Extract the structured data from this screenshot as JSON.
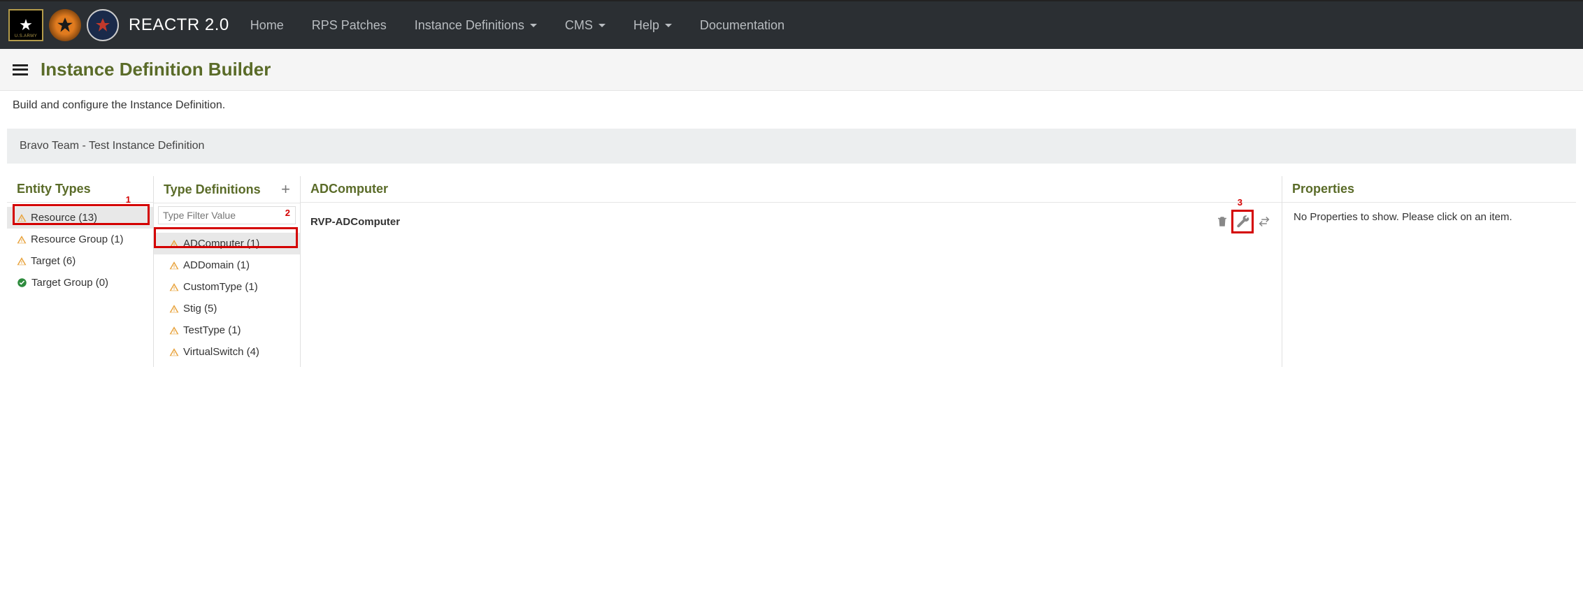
{
  "brand": "REACTR 2.0",
  "nav": {
    "home": "Home",
    "rps": "RPS Patches",
    "instdef": "Instance Definitions",
    "cms": "CMS",
    "help": "Help",
    "docs": "Documentation"
  },
  "page": {
    "title": "Instance Definition Builder",
    "description": "Build and configure the Instance Definition.",
    "breadcrumb": "Bravo Team - Test Instance Definition"
  },
  "entity": {
    "header": "Entity Types",
    "items": [
      {
        "label": "Resource (13)",
        "status": "warn",
        "selected": true
      },
      {
        "label": "Resource Group (1)",
        "status": "warn",
        "selected": false
      },
      {
        "label": "Target (6)",
        "status": "warn",
        "selected": false
      },
      {
        "label": "Target Group (0)",
        "status": "ok",
        "selected": false
      }
    ]
  },
  "typedef": {
    "header": "Type Definitions",
    "filter_placeholder": "Type Filter Value",
    "items": [
      {
        "label": "ADComputer (1)",
        "status": "warn",
        "selected": true
      },
      {
        "label": "ADDomain (1)",
        "status": "warn",
        "selected": false
      },
      {
        "label": "CustomType (1)",
        "status": "warn",
        "selected": false
      },
      {
        "label": "Stig (5)",
        "status": "warn",
        "selected": false
      },
      {
        "label": "TestType (1)",
        "status": "warn",
        "selected": false
      },
      {
        "label": "VirtualSwitch (4)",
        "status": "warn",
        "selected": false
      }
    ]
  },
  "detail": {
    "header": "ADComputer",
    "row_name": "RVP-ADComputer"
  },
  "props": {
    "header": "Properties",
    "empty": "No Properties to show. Please click on an item."
  },
  "annotations": {
    "n1": "1",
    "n2": "2",
    "n3": "3"
  }
}
